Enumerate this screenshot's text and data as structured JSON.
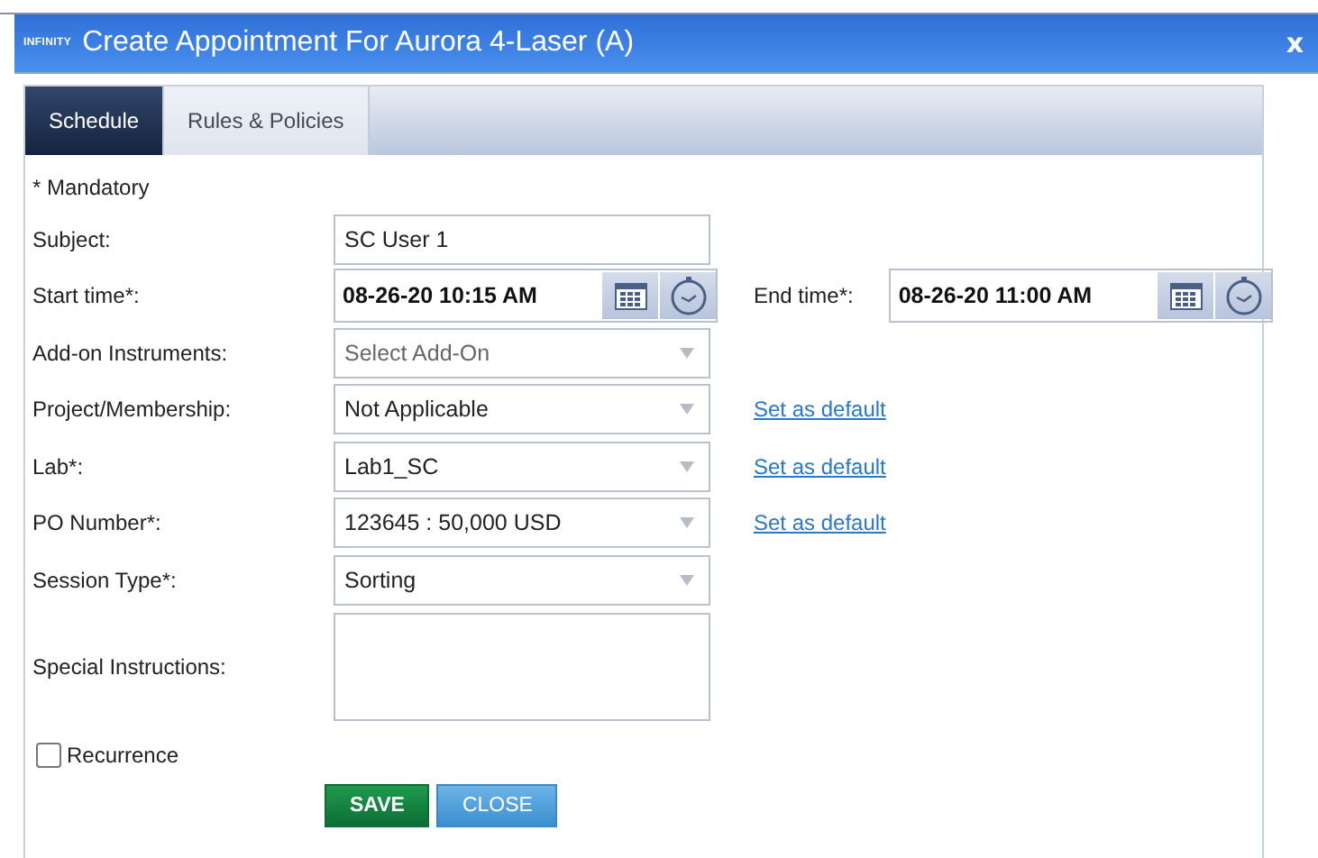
{
  "window": {
    "logo": "INFINITY",
    "title": "Create Appointment For Aurora 4-Laser (A)",
    "close": "x"
  },
  "tabs": [
    {
      "label": "Schedule",
      "selected": true
    },
    {
      "label": "Rules & Policies",
      "selected": false
    }
  ],
  "mandatory_note": "* Mandatory",
  "rows": [
    {
      "kind": "text",
      "label": "Subject:",
      "value": "SC User 1"
    },
    {
      "kind": "datetime",
      "label": "Start time*:",
      "value": "08-26-20 10:15 AM",
      "end_label": "End time*:",
      "end_value": "08-26-20 11:00 AM"
    },
    {
      "kind": "select",
      "label": "Add-on Instruments:",
      "placeholder": "Select Add-On"
    },
    {
      "kind": "select",
      "label": "Project/Membership:",
      "value": "Not Applicable",
      "link": "Set as default"
    },
    {
      "kind": "select",
      "label": "Lab*:",
      "value": "Lab1_SC",
      "link": "Set as default"
    },
    {
      "kind": "select",
      "label": "PO Number*:",
      "value": "123645  : 50,000 USD",
      "link": "Set as default"
    },
    {
      "kind": "select",
      "label": "Session Type*:",
      "value": "Sorting"
    },
    {
      "kind": "textarea",
      "label": "Special Instructions:"
    }
  ],
  "recurrence": {
    "label": "Recurrence",
    "checked": false
  },
  "buttons": [
    {
      "label": "SAVE",
      "kind": "primary"
    },
    {
      "label": "CLOSE",
      "kind": "secondary"
    }
  ]
}
